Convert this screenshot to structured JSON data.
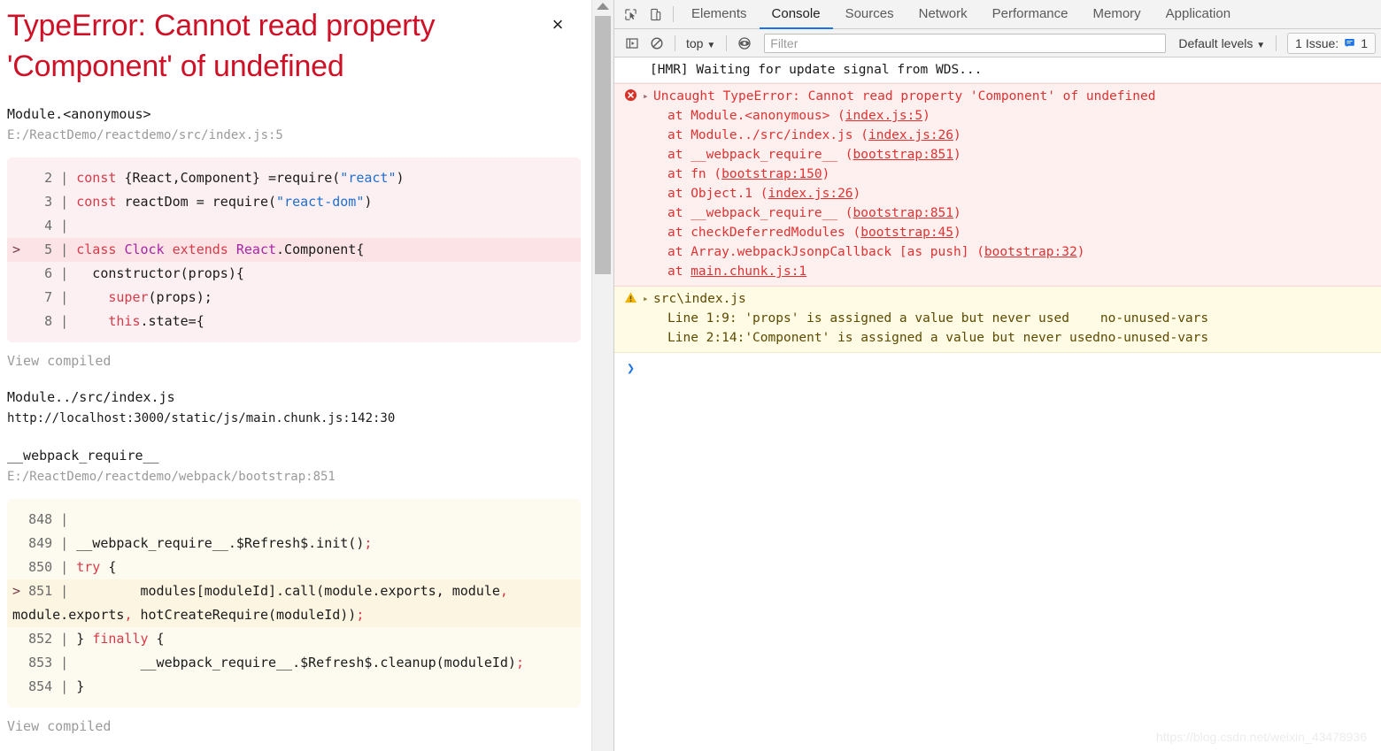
{
  "overlay": {
    "error_title": "TypeError: Cannot read property\n'Component' of undefined",
    "close_label": "×",
    "frames": [
      {
        "fn": "Module.<anonymous>",
        "loc": "E:/ReactDemo/reactdemo/src/index.js:5",
        "view_compiled": "View compiled"
      },
      {
        "fn": "Module../src/index.js",
        "loc": "http://localhost:3000/static/js/main.chunk.js:142:30"
      },
      {
        "fn": "__webpack_require__",
        "loc": "E:/ReactDemo/reactdemo/webpack/bootstrap:851",
        "view_compiled": "View compiled"
      }
    ],
    "snippet_one": {
      "lines": [
        {
          "marker": "",
          "num": "2",
          "highlight": false,
          "tokens": [
            {
              "t": "const ",
              "c": "kw"
            },
            {
              "t": "{React,Component} =",
              "c": "pl"
            },
            {
              "t": "require",
              "c": "pl"
            },
            {
              "t": "(",
              "c": "pl"
            },
            {
              "t": "\"react\"",
              "c": "str"
            },
            {
              "t": ")",
              "c": "pl"
            }
          ]
        },
        {
          "marker": "",
          "num": "3",
          "highlight": false,
          "tokens": [
            {
              "t": "const ",
              "c": "kw"
            },
            {
              "t": "reactDom = require(",
              "c": "pl"
            },
            {
              "t": "\"react-dom\"",
              "c": "str"
            },
            {
              "t": ")",
              "c": "pl"
            }
          ]
        },
        {
          "marker": "",
          "num": "4",
          "highlight": false,
          "tokens": []
        },
        {
          "marker": ">",
          "num": "5",
          "highlight": true,
          "tokens": [
            {
              "t": "class ",
              "c": "kw"
            },
            {
              "t": "Clock",
              "c": "cls"
            },
            {
              "t": " extends ",
              "c": "kw"
            },
            {
              "t": "React",
              "c": "cls"
            },
            {
              "t": ".Component{",
              "c": "pl"
            }
          ]
        },
        {
          "marker": "",
          "num": "6",
          "highlight": false,
          "tokens": [
            {
              "t": "  constructor(props){",
              "c": "pl"
            }
          ]
        },
        {
          "marker": "",
          "num": "7",
          "highlight": false,
          "tokens": [
            {
              "t": "    ",
              "c": "pl"
            },
            {
              "t": "super",
              "c": "kw"
            },
            {
              "t": "(props);",
              "c": "pl"
            }
          ]
        },
        {
          "marker": "",
          "num": "8",
          "highlight": false,
          "tokens": [
            {
              "t": "    ",
              "c": "pl"
            },
            {
              "t": "this",
              "c": "kw"
            },
            {
              "t": ".state={",
              "c": "pl"
            }
          ]
        }
      ]
    },
    "snippet_two": {
      "lines": [
        {
          "marker": "",
          "num": "848",
          "highlight": false,
          "tokens": []
        },
        {
          "marker": "",
          "num": "849",
          "highlight": false,
          "tokens": [
            {
              "t": "__webpack_require__.$Refresh$.init()",
              "c": "pl"
            },
            {
              "t": ";",
              "c": "kw"
            }
          ]
        },
        {
          "marker": "",
          "num": "850",
          "highlight": false,
          "tokens": [
            {
              "t": "try",
              "c": "kw"
            },
            {
              "t": " {",
              "c": "pl"
            }
          ]
        },
        {
          "marker": ">",
          "num": "851",
          "highlight": true,
          "tokens": [
            {
              "t": "        modules[moduleId].call(module.exports, module",
              "c": "pl"
            },
            {
              "t": ",",
              "c": "kw"
            },
            {
              "t": "\nmodule.exports",
              "c": "pl"
            },
            {
              "t": ",",
              "c": "kw"
            },
            {
              "t": " hotCreateRequire(moduleId))",
              "c": "pl"
            },
            {
              "t": ";",
              "c": "kw"
            }
          ]
        },
        {
          "marker": "",
          "num": "852",
          "highlight": false,
          "tokens": [
            {
              "t": "} ",
              "c": "pl"
            },
            {
              "t": "finally",
              "c": "kw"
            },
            {
              "t": " {",
              "c": "pl"
            }
          ]
        },
        {
          "marker": "",
          "num": "853",
          "highlight": false,
          "tokens": [
            {
              "t": "        __webpack_require__.$Refresh$.cleanup(moduleId)",
              "c": "pl"
            },
            {
              "t": ";",
              "c": "kw"
            }
          ]
        },
        {
          "marker": "",
          "num": "854",
          "highlight": false,
          "tokens": [
            {
              "t": "}",
              "c": "pl"
            }
          ]
        }
      ]
    },
    "final_view_compiled": "View compiled"
  },
  "devtools": {
    "tabs": [
      {
        "label": "Elements",
        "active": false
      },
      {
        "label": "Console",
        "active": true
      },
      {
        "label": "Sources",
        "active": false
      },
      {
        "label": "Network",
        "active": false
      },
      {
        "label": "Performance",
        "active": false
      },
      {
        "label": "Memory",
        "active": false
      },
      {
        "label": "Application",
        "active": false
      }
    ],
    "toolbar": {
      "context": "top",
      "context_caret": "▼",
      "filter_placeholder": "Filter",
      "filter_value": "",
      "levels_label": "Default levels",
      "levels_caret": "▼",
      "issues_label": "1 Issue:",
      "issues_count": "1"
    },
    "console": {
      "info_message": "[HMR] Waiting for update signal from WDS...",
      "error": {
        "headline": "Uncaught TypeError: Cannot read property 'Component' of undefined",
        "stack": [
          {
            "text": "    at Module.<anonymous> (",
            "link": "index.js:5",
            "tail": ")"
          },
          {
            "text": "    at Module../src/index.js (",
            "link": "index.js:26",
            "tail": ")"
          },
          {
            "text": "    at __webpack_require__ (",
            "link": "bootstrap:851",
            "tail": ")"
          },
          {
            "text": "    at fn (",
            "link": "bootstrap:150",
            "tail": ")"
          },
          {
            "text": "    at Object.1 (",
            "link": "index.js:26",
            "tail": ")"
          },
          {
            "text": "    at __webpack_require__ (",
            "link": "bootstrap:851",
            "tail": ")"
          },
          {
            "text": "    at checkDeferredModules (",
            "link": "bootstrap:45",
            "tail": ")"
          },
          {
            "text": "    at Array.webpackJsonpCallback [as push] (",
            "link": "bootstrap:32",
            "tail": ")"
          },
          {
            "text": "    at ",
            "link": "main.chunk.js:1",
            "tail": ""
          }
        ]
      },
      "warning": {
        "headline": "src\\index.js",
        "lines": [
          {
            "loc": "Line 1:9:",
            "message": "'props' is assigned a value but never used",
            "rule": "no-unused-vars"
          },
          {
            "loc": "Line 2:14:",
            "message": "'Component' is assigned a value but never used",
            "rule": "no-unused-vars"
          }
        ]
      },
      "prompt_symbol": "❯"
    }
  },
  "watermark": "https://blog.csdn.net/weixin_43478936"
}
